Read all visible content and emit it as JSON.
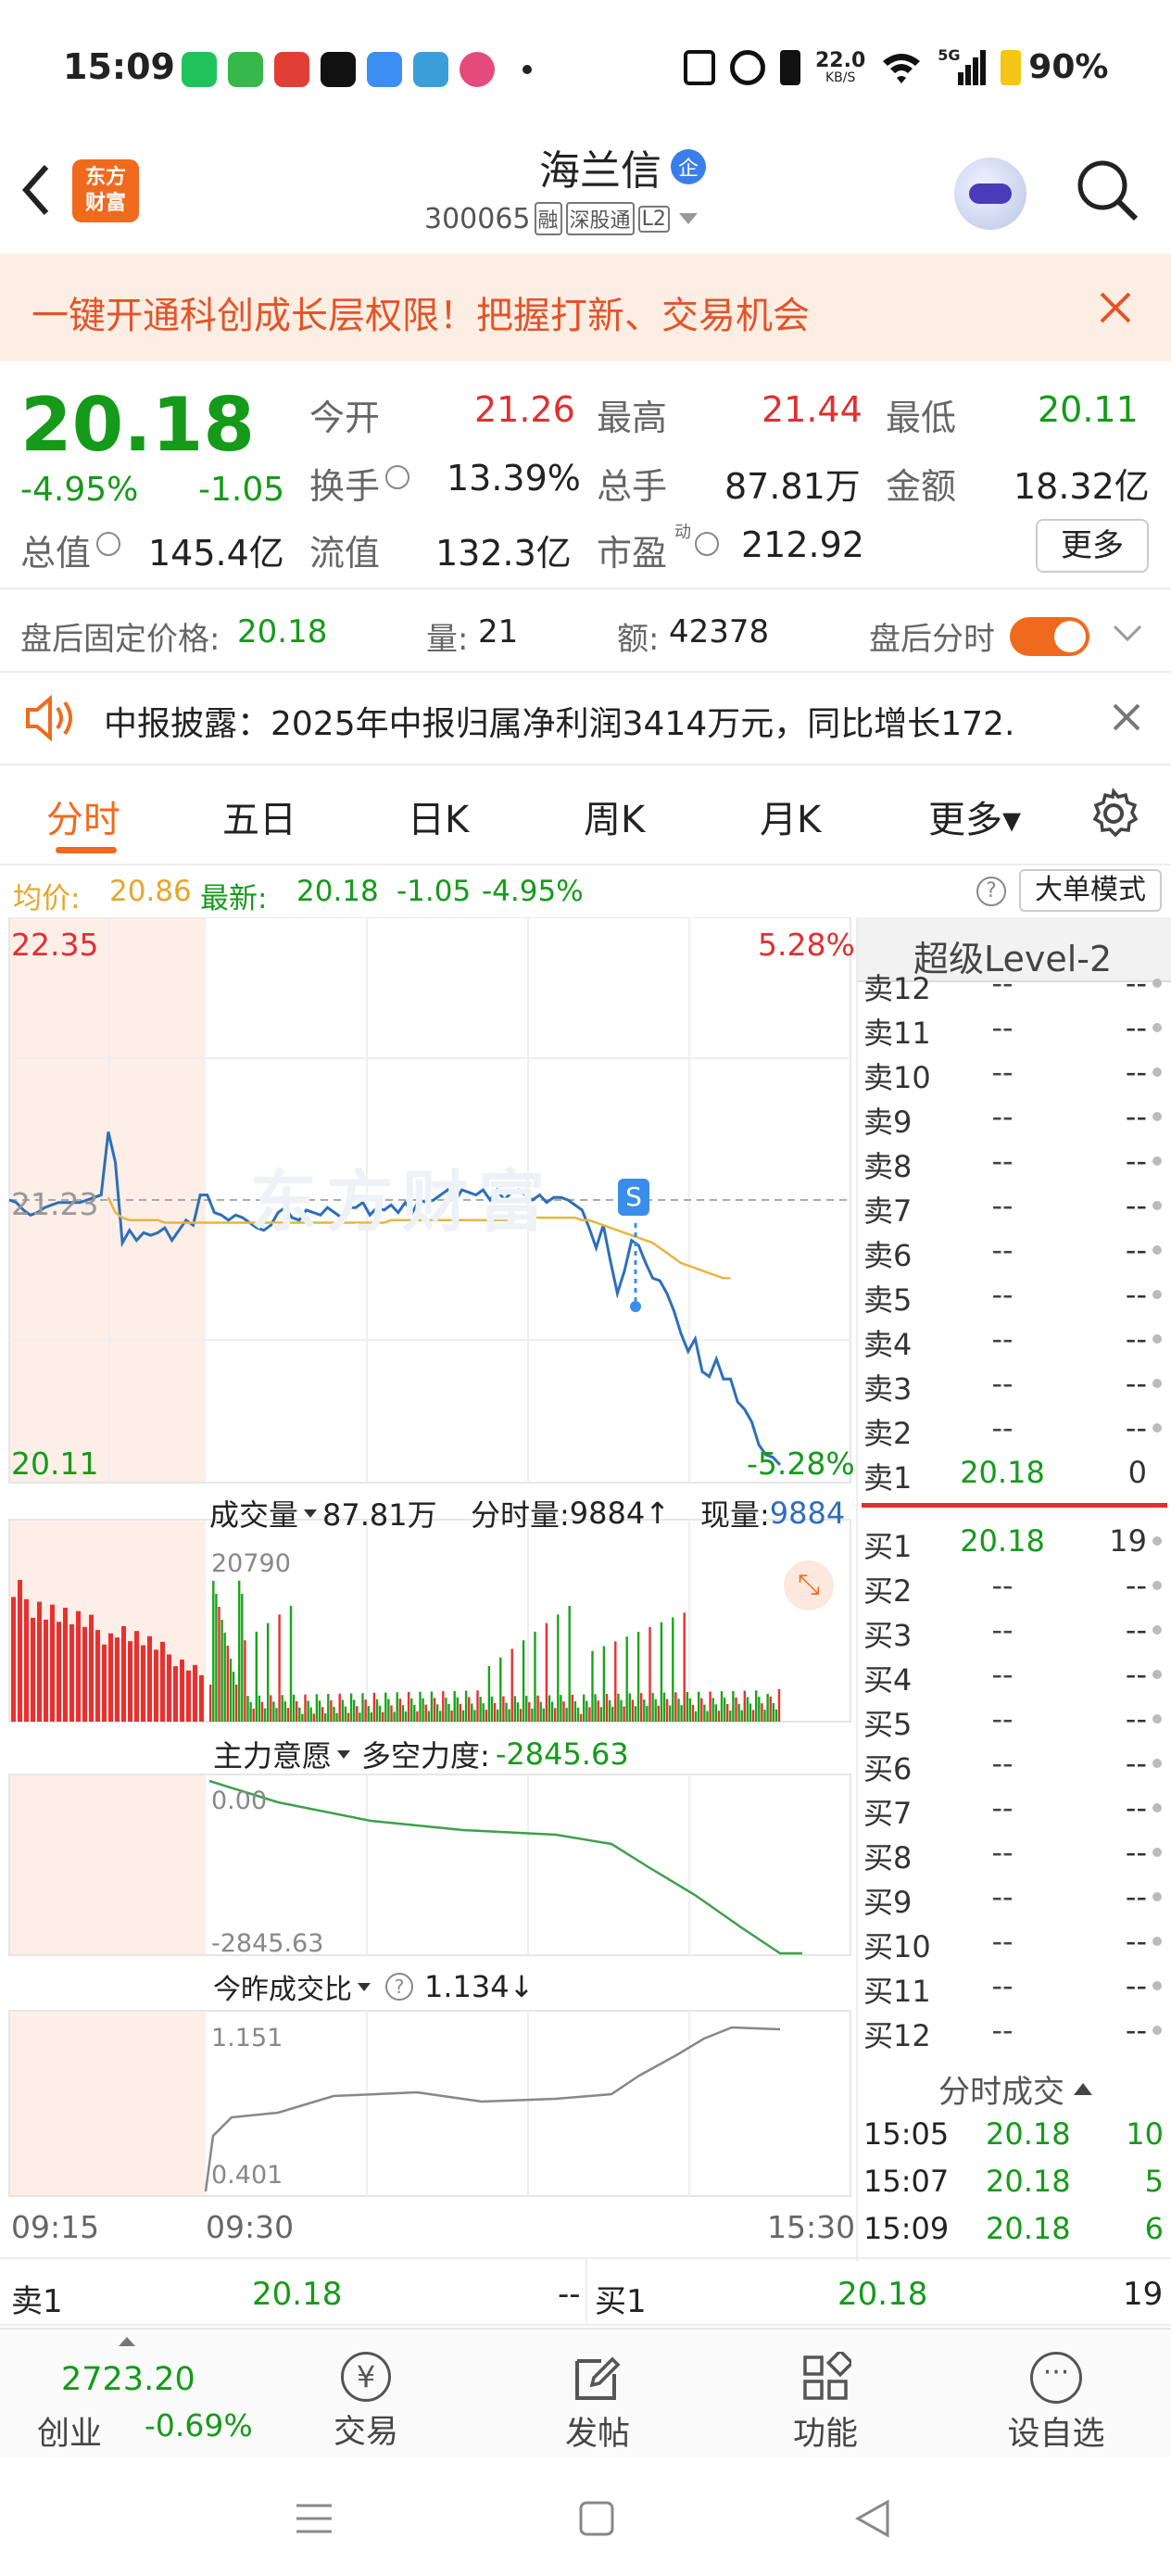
{
  "status_bar": {
    "time": "15:09",
    "net_speed_value": "22.0",
    "net_speed_unit": "KB/S",
    "signal_label": "5G",
    "battery": "90%",
    "app_icons": [
      "wechat-icon",
      "message-icon",
      "toutiao-icon",
      "tiktok-icon",
      "cloud-icon",
      "tree-icon",
      "bird-icon"
    ]
  },
  "header": {
    "stock_name": "海兰信",
    "badge": "企",
    "code": "300065",
    "tag_margin": "融",
    "tag_connect": "深股通",
    "tag_level": "L2",
    "logo_line1": "东方",
    "logo_line2": "财富"
  },
  "banner": {
    "text": "一键开通科创成长层权限！把握打新、交易机会"
  },
  "quote": {
    "price": "20.18",
    "change_pct": "-4.95%",
    "change": "-1.05",
    "open_label": "今开",
    "open": "21.26",
    "high_label": "最高",
    "high": "21.44",
    "low_label": "最低",
    "low": "20.11",
    "turnover_label": "换手",
    "turnover": "13.39%",
    "volume_label": "总手",
    "volume": "87.81万",
    "amount_label": "金额",
    "amount": "18.32亿",
    "mcap_label": "总值",
    "mcap": "145.4亿",
    "float_label": "流值",
    "float": "132.3亿",
    "pe_label": "市盈",
    "pe_sup": "动",
    "pe": "212.92",
    "more_label": "更多"
  },
  "after_hours": {
    "label": "盘后固定价格:",
    "price": "20.18",
    "qty_label": "量:",
    "qty": "21",
    "amt_label": "额:",
    "amt": "42378",
    "toggle_label": "盘后分时",
    "toggle_on": true
  },
  "notice": {
    "text": "中报披露：2025年中报归属净利润3414万元，同比增长172."
  },
  "tabs": [
    {
      "label": "分时",
      "active": true
    },
    {
      "label": "五日"
    },
    {
      "label": "日K"
    },
    {
      "label": "周K"
    },
    {
      "label": "月K"
    },
    {
      "label": "更多▾"
    }
  ],
  "info_line": {
    "avg_label": "均价:",
    "avg": "20.86",
    "latest_label": "最新:",
    "latest": "20.18",
    "change": "-1.05",
    "change_pct": "-4.95%",
    "big_order_label": "大单模式"
  },
  "chart": {
    "y_max": "22.35",
    "y_mid": "21.23",
    "y_min": "20.11",
    "pct_max": "5.28%",
    "pct_min": "-5.28%",
    "watermark": "东方财富",
    "signal_label": "S",
    "vol_label": "成交量",
    "vol_total": "87.81万",
    "vol_period_label": "分时量:",
    "vol_period": "9884↑",
    "vol_now_label": "现量:",
    "vol_now": "9884",
    "vol_scale": "20790",
    "mf_label": "主力意愿",
    "mf_desc_label": "多空力度:",
    "mf_value": "-2845.63",
    "mf_top": "0.00",
    "mf_bottom": "-2845.63",
    "ratio_label": "今昨成交比",
    "ratio_value": "1.134↓",
    "ratio_top": "1.151",
    "ratio_bottom": "0.401",
    "time_start": "09:15",
    "time_open": "09:30",
    "time_end": "15:30"
  },
  "chart_data": {
    "type": "line",
    "title": "",
    "x_range": [
      "09:15",
      "15:30"
    ],
    "ylim": [
      20.11,
      22.35
    ],
    "prev_close": 21.23,
    "series": [],
    "price": [
      21.23,
      21.22,
      21.19,
      21.17,
      21.18,
      21.2,
      21.21,
      21.22,
      21.22,
      21.22,
      21.22,
      21.23,
      21.24,
      21.25,
      21.5,
      21.38,
      21.06,
      21.11,
      21.07,
      21.1,
      21.09,
      21.1,
      21.12,
      21.07,
      21.11,
      21.15,
      21.13,
      21.25,
      21.25,
      21.18,
      21.17,
      21.15,
      21.17,
      21.16,
      21.14,
      21.12,
      21.11,
      21.13,
      21.18,
      21.2,
      21.16,
      21.15,
      21.19,
      21.18,
      21.17,
      21.2,
      21.18,
      21.16,
      21.2,
      21.2,
      21.22,
      21.17,
      21.2,
      21.19,
      21.21,
      21.18,
      21.22,
      21.18,
      21.23,
      21.22,
      21.23,
      21.25,
      21.27,
      21.22,
      21.27,
      21.26,
      21.25,
      21.27,
      21.23,
      21.27,
      21.23,
      21.26,
      21.27,
      21.25,
      21.23,
      21.25,
      21.22,
      21.24,
      21.24,
      21.23,
      21.21,
      21.19,
      21.12,
      21.04,
      21.13,
      20.99,
      20.86,
      20.95,
      21.07,
      21.05,
      20.98,
      20.92,
      20.91,
      20.86,
      20.79,
      20.7,
      20.63,
      20.68,
      20.55,
      20.53,
      20.6,
      20.52,
      20.52,
      20.43,
      20.4,
      20.35,
      20.26,
      20.22,
      20.21,
      20.18
    ],
    "avg": [
      null,
      null,
      null,
      null,
      null,
      null,
      null,
      null,
      null,
      null,
      null,
      null,
      null,
      null,
      21.24,
      21.18,
      21.16,
      21.15,
      21.15,
      21.15,
      21.15,
      21.15,
      21.14,
      21.14,
      21.14,
      21.14,
      21.14,
      21.14,
      21.14,
      21.14,
      21.14,
      21.14,
      21.14,
      21.14,
      21.14,
      21.14,
      21.14,
      21.14,
      21.14,
      21.14,
      21.14,
      21.14,
      21.14,
      21.14,
      21.14,
      21.14,
      21.14,
      21.14,
      21.14,
      21.14,
      21.14,
      21.14,
      21.14,
      21.14,
      21.15,
      21.15,
      21.15,
      21.15,
      21.15,
      21.15,
      21.15,
      21.15,
      21.15,
      21.15,
      21.15,
      21.15,
      21.15,
      21.15,
      21.15,
      21.15,
      21.15,
      21.15,
      21.16,
      21.16,
      21.16,
      21.16,
      21.16,
      21.16,
      21.16,
      21.16,
      21.16,
      21.15,
      21.15,
      21.14,
      21.13,
      21.12,
      21.11,
      21.1,
      21.09,
      21.08,
      21.07,
      21.06,
      21.04,
      21.02,
      21.0,
      20.98,
      20.97,
      20.96,
      20.95,
      20.94,
      20.93,
      20.92,
      20.92,
      null,
      null,
      null,
      null,
      null,
      null,
      null
    ],
    "volume_max": 20790,
    "moneyflow_range": [
      -2845.63,
      0.0
    ],
    "ratio_range": [
      0.401,
      1.151
    ]
  },
  "order_book": {
    "title": "超级Level-2",
    "asks": [
      {
        "label": "卖12",
        "price": "--",
        "qty": "--"
      },
      {
        "label": "卖11",
        "price": "--",
        "qty": "--"
      },
      {
        "label": "卖10",
        "price": "--",
        "qty": "--"
      },
      {
        "label": "卖9",
        "price": "--",
        "qty": "--"
      },
      {
        "label": "卖8",
        "price": "--",
        "qty": "--"
      },
      {
        "label": "卖7",
        "price": "--",
        "qty": "--"
      },
      {
        "label": "卖6",
        "price": "--",
        "qty": "--"
      },
      {
        "label": "卖5",
        "price": "--",
        "qty": "--"
      },
      {
        "label": "卖4",
        "price": "--",
        "qty": "--"
      },
      {
        "label": "卖3",
        "price": "--",
        "qty": "--"
      },
      {
        "label": "卖2",
        "price": "--",
        "qty": "--"
      },
      {
        "label": "卖1",
        "price": "20.18",
        "qty": "0"
      }
    ],
    "bids": [
      {
        "label": "买1",
        "price": "20.18",
        "qty": "19"
      },
      {
        "label": "买2",
        "price": "--",
        "qty": "--"
      },
      {
        "label": "买3",
        "price": "--",
        "qty": "--"
      },
      {
        "label": "买4",
        "price": "--",
        "qty": "--"
      },
      {
        "label": "买5",
        "price": "--",
        "qty": "--"
      },
      {
        "label": "买6",
        "price": "--",
        "qty": "--"
      },
      {
        "label": "买7",
        "price": "--",
        "qty": "--"
      },
      {
        "label": "买8",
        "price": "--",
        "qty": "--"
      },
      {
        "label": "买9",
        "price": "--",
        "qty": "--"
      },
      {
        "label": "买10",
        "price": "--",
        "qty": "--"
      },
      {
        "label": "买11",
        "price": "--",
        "qty": "--"
      },
      {
        "label": "买12",
        "price": "--",
        "qty": "--"
      }
    ],
    "trades_title": "分时成交",
    "trades": [
      {
        "time": "15:05",
        "price": "20.18",
        "qty": "10"
      },
      {
        "time": "15:07",
        "price": "20.18",
        "qty": "5"
      },
      {
        "time": "15:09",
        "price": "20.18",
        "qty": "6"
      }
    ]
  },
  "bottom_quote": {
    "ask_label": "卖1",
    "ask_price": "20.18",
    "ask_qty": "--",
    "bid_label": "买1",
    "bid_price": "20.18",
    "bid_qty": "19"
  },
  "bottom_bar": {
    "index_value": "2723.20",
    "index_name": "创业",
    "index_change": "-0.69%",
    "trade": "交易",
    "post": "发帖",
    "func": "功能",
    "watch": "设自选"
  },
  "colors": {
    "up": "#e03030",
    "down": "#159a1a",
    "accent": "#ff6a00",
    "price_line": "#2d6fb8",
    "avg_line": "#e9b440",
    "banner_bg": "#fdeee3"
  }
}
